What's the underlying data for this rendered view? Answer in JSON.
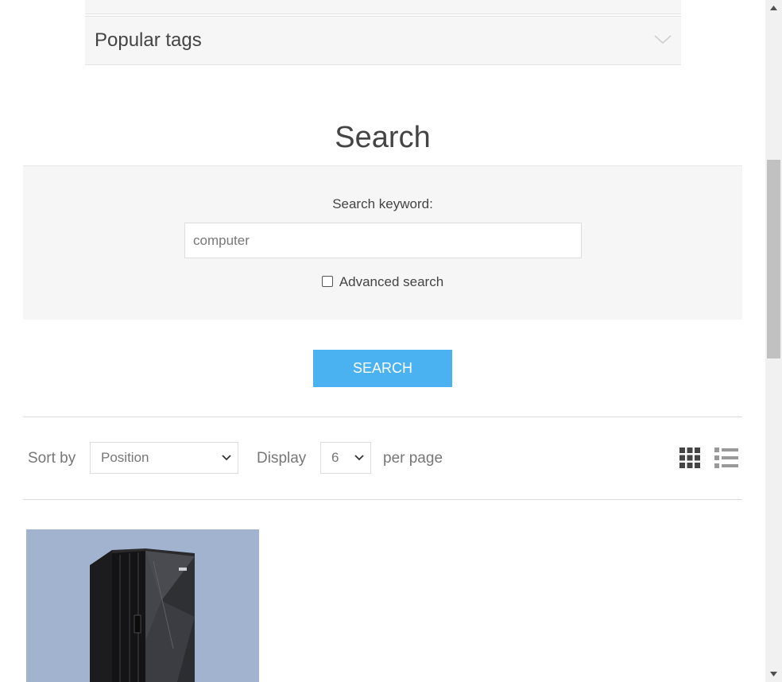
{
  "accordion": {
    "popular_tags_label": "Popular tags"
  },
  "page": {
    "title": "Search"
  },
  "search_form": {
    "keyword_label": "Search keyword:",
    "keyword_value": "computer",
    "advanced_label": "Advanced search",
    "advanced_checked": false,
    "submit_label": "SEARCH"
  },
  "toolbar": {
    "sort_label": "Sort by",
    "sort_selected": "Position",
    "display_label": "Display",
    "display_selected": "6",
    "per_page_label": "per page",
    "view_modes": [
      "grid-view-icon",
      "list-view-icon"
    ],
    "active_view": "grid"
  },
  "colors": {
    "accent_button": "#4ab2f1",
    "panel_bg": "#f6f6f6",
    "product_image_bg": "#a2b3cf"
  }
}
